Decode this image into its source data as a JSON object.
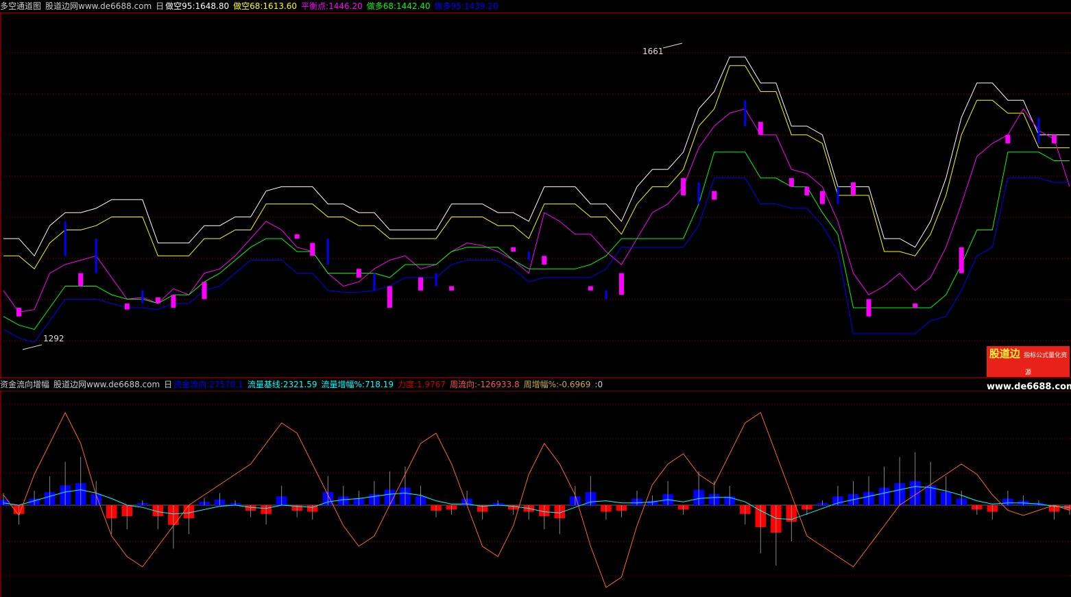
{
  "top_header": {
    "title": "多空通道图",
    "site": "股道边网www.de6688.com",
    "period": "日",
    "items": [
      {
        "label": "做空95:1648.80",
        "color": "#ffffff"
      },
      {
        "label": "做空68:1613.60",
        "color": "#ffff00"
      },
      {
        "label": "平衡点:1446.20",
        "color": "#ff00ff"
      },
      {
        "label": "做多68:1442.40",
        "color": "#00ff00"
      },
      {
        "label": "做多95:1439.20",
        "color": "#0000ff"
      }
    ]
  },
  "bottom_header": {
    "title": "资金流向增幅",
    "site": "股道边网www.de6688.com",
    "period": "日",
    "items": [
      {
        "label": "资金流向:27570.1",
        "color": "#0000ff"
      },
      {
        "label": "流量基线:2321.59",
        "color": "#00ffff"
      },
      {
        "label": "流量增幅%:718.19",
        "color": "#00ffff"
      },
      {
        "label": "力度:1.9767",
        "color": "#cc0000"
      },
      {
        "label": "周流向:-126933.8",
        "color": "#ff5555"
      },
      {
        "label": "周增幅%:-0.6969",
        "color": "#ccaa44"
      },
      {
        "label": ":0",
        "color": "#cccccc"
      }
    ]
  },
  "watermark": {
    "line1": "股道边",
    "line1_small": "指标公式量化资源",
    "line2": "www.de6688.com"
  },
  "colors": {
    "grid": "#a00000",
    "border": "#cc0000",
    "up_candle": "#ff00ff",
    "down_candle": "#0000ff"
  },
  "chart_data": [
    {
      "type": "line",
      "title": "多空通道图",
      "annotations": [
        {
          "text": "1661"
        },
        {
          "text": "1292"
        }
      ],
      "series": [
        {
          "name": "做空95",
          "color": "#ffffff",
          "values": [
            1440,
            1440,
            1420,
            1455,
            1470,
            1470,
            1475,
            1485,
            1485,
            1485,
            1435,
            1435,
            1435,
            1455,
            1455,
            1465,
            1465,
            1495,
            1500,
            1500,
            1500,
            1480,
            1480,
            1470,
            1470,
            1450,
            1450,
            1450,
            1450,
            1480,
            1480,
            1480,
            1470,
            1470,
            1460,
            1500,
            1500,
            1500,
            1480,
            1480,
            1460,
            1500,
            1520,
            1520,
            1540,
            1590,
            1610,
            1650,
            1650,
            1620,
            1620,
            1570,
            1570,
            1560,
            1500,
            1500,
            1500,
            1440,
            1440,
            1430,
            1460,
            1510,
            1580,
            1620,
            1620,
            1600,
            1600,
            1560,
            1560,
            1560
          ]
        },
        {
          "name": "做空68",
          "color": "#ffff00",
          "values": [
            1420,
            1420,
            1405,
            1435,
            1450,
            1450,
            1455,
            1465,
            1465,
            1465,
            1420,
            1420,
            1420,
            1440,
            1440,
            1450,
            1450,
            1480,
            1480,
            1480,
            1480,
            1465,
            1465,
            1455,
            1455,
            1440,
            1440,
            1440,
            1440,
            1465,
            1465,
            1465,
            1455,
            1455,
            1440,
            1480,
            1480,
            1480,
            1465,
            1465,
            1445,
            1480,
            1500,
            1500,
            1520,
            1570,
            1590,
            1640,
            1640,
            1610,
            1610,
            1560,
            1560,
            1550,
            1490,
            1490,
            1490,
            1425,
            1425,
            1420,
            1445,
            1490,
            1560,
            1600,
            1600,
            1585,
            1585,
            1545,
            1545,
            1545
          ]
        },
        {
          "name": "平衡点",
          "color": "#ff00ff",
          "values": [
            1380,
            1355,
            1358,
            1400,
            1410,
            1415,
            1420,
            1395,
            1370,
            1372,
            1365,
            1382,
            1375,
            1400,
            1405,
            1420,
            1440,
            1460,
            1450,
            1430,
            1425,
            1400,
            1385,
            1390,
            1405,
            1415,
            1420,
            1405,
            1410,
            1425,
            1435,
            1432,
            1425,
            1415,
            1400,
            1470,
            1460,
            1445,
            1445,
            1425,
            1410,
            1440,
            1470,
            1480,
            1500,
            1545,
            1570,
            1585,
            1590,
            1560,
            1560,
            1520,
            1515,
            1500,
            1460,
            1400,
            1375,
            1385,
            1400,
            1380,
            1395,
            1430,
            1480,
            1535,
            1550,
            1560,
            1590,
            1565,
            1555,
            1500
          ]
        },
        {
          "name": "做多68",
          "color": "#00ff00",
          "values": [
            1350,
            1340,
            1335,
            1360,
            1385,
            1385,
            1385,
            1375,
            1370,
            1370,
            1365,
            1375,
            1375,
            1390,
            1400,
            1415,
            1430,
            1440,
            1440,
            1425,
            1425,
            1400,
            1400,
            1400,
            1400,
            1395,
            1410,
            1410,
            1410,
            1425,
            1430,
            1430,
            1430,
            1415,
            1405,
            1405,
            1405,
            1405,
            1410,
            1420,
            1440,
            1440,
            1440,
            1440,
            1440,
            1480,
            1540,
            1540,
            1540,
            1510,
            1510,
            1500,
            1500,
            1470,
            1445,
            1360,
            1360,
            1360,
            1360,
            1360,
            1360,
            1375,
            1410,
            1450,
            1450,
            1540,
            1540,
            1540,
            1530,
            1530
          ]
        },
        {
          "name": "做多95",
          "color": "#0000ff",
          "values": [
            1335,
            1325,
            1320,
            1345,
            1370,
            1370,
            1370,
            1365,
            1360,
            1360,
            1358,
            1365,
            1365,
            1380,
            1385,
            1400,
            1415,
            1415,
            1415,
            1400,
            1400,
            1380,
            1378,
            1378,
            1380,
            1385,
            1395,
            1395,
            1395,
            1410,
            1415,
            1415,
            1415,
            1405,
            1390,
            1395,
            1395,
            1395,
            1395,
            1405,
            1430,
            1430,
            1430,
            1430,
            1430,
            1455,
            1510,
            1510,
            1510,
            1480,
            1480,
            1475,
            1475,
            1455,
            1425,
            1330,
            1330,
            1330,
            1330,
            1330,
            1345,
            1350,
            1380,
            1420,
            1430,
            1510,
            1510,
            1510,
            1505,
            1505
          ]
        }
      ],
      "candles": [
        {
          "i": 1,
          "o": 1360,
          "c": 1350,
          "up": true
        },
        {
          "i": 4,
          "o": 1420,
          "c": 1460,
          "up": false
        },
        {
          "i": 5,
          "o": 1400,
          "c": 1385,
          "up": true
        },
        {
          "i": 6,
          "o": 1440,
          "c": 1400,
          "up": false
        },
        {
          "i": 8,
          "o": 1365,
          "c": 1358,
          "up": true
        },
        {
          "i": 9,
          "o": 1380,
          "c": 1365,
          "up": false
        },
        {
          "i": 10,
          "o": 1372,
          "c": 1365,
          "up": true
        },
        {
          "i": 11,
          "o": 1375,
          "c": 1360,
          "up": true
        },
        {
          "i": 13,
          "o": 1390,
          "c": 1370,
          "up": true
        },
        {
          "i": 19,
          "o": 1440,
          "c": 1445,
          "up": true
        },
        {
          "i": 20,
          "o": 1435,
          "c": 1420,
          "up": true
        },
        {
          "i": 21,
          "o": 1440,
          "c": 1410,
          "up": false
        },
        {
          "i": 23,
          "o": 1405,
          "c": 1395,
          "up": true
        },
        {
          "i": 24,
          "o": 1400,
          "c": 1380,
          "up": false
        },
        {
          "i": 25,
          "o": 1385,
          "c": 1360,
          "up": true
        },
        {
          "i": 27,
          "o": 1395,
          "c": 1380,
          "up": true
        },
        {
          "i": 28,
          "o": 1400,
          "c": 1385,
          "up": false
        },
        {
          "i": 29,
          "o": 1385,
          "c": 1380,
          "up": true
        },
        {
          "i": 33,
          "o": 1430,
          "c": 1425,
          "up": true
        },
        {
          "i": 34,
          "o": 1425,
          "c": 1415,
          "up": false
        },
        {
          "i": 35,
          "o": 1420,
          "c": 1410,
          "up": true
        },
        {
          "i": 38,
          "o": 1385,
          "c": 1380,
          "up": true
        },
        {
          "i": 39,
          "o": 1380,
          "c": 1370,
          "up": false
        },
        {
          "i": 40,
          "o": 1400,
          "c": 1375,
          "up": true
        },
        {
          "i": 44,
          "o": 1510,
          "c": 1490,
          "up": true
        },
        {
          "i": 45,
          "o": 1505,
          "c": 1480,
          "up": false
        },
        {
          "i": 46,
          "o": 1495,
          "c": 1485,
          "up": true
        },
        {
          "i": 48,
          "o": 1600,
          "c": 1570,
          "up": false
        },
        {
          "i": 49,
          "o": 1575,
          "c": 1560,
          "up": true
        },
        {
          "i": 51,
          "o": 1510,
          "c": 1500,
          "up": true
        },
        {
          "i": 52,
          "o": 1500,
          "c": 1490,
          "up": true
        },
        {
          "i": 53,
          "o": 1495,
          "c": 1480,
          "up": true
        },
        {
          "i": 54,
          "o": 1500,
          "c": 1480,
          "up": false
        },
        {
          "i": 55,
          "o": 1505,
          "c": 1490,
          "up": true
        },
        {
          "i": 56,
          "o": 1370,
          "c": 1350,
          "up": true
        },
        {
          "i": 59,
          "o": 1365,
          "c": 1360,
          "up": true
        },
        {
          "i": 62,
          "o": 1430,
          "c": 1400,
          "up": true
        },
        {
          "i": 65,
          "o": 1560,
          "c": 1550,
          "up": true
        },
        {
          "i": 67,
          "o": 1580,
          "c": 1550,
          "up": false
        },
        {
          "i": 68,
          "o": 1560,
          "c": 1550,
          "up": true
        }
      ],
      "ylim": [
        1280,
        1700
      ]
    },
    {
      "type": "bar",
      "title": "资金流向增幅",
      "series": [
        {
          "name": "资金流向",
          "color_pos": "#0000ff",
          "color_neg": "#ff0000",
          "values": [
            5,
            -8,
            6,
            12,
            18,
            20,
            10,
            -12,
            -10,
            2,
            -10,
            -18,
            -12,
            3,
            5,
            2,
            -5,
            -8,
            8,
            -5,
            -6,
            12,
            8,
            6,
            10,
            14,
            16,
            8,
            -5,
            -4,
            6,
            -6,
            2,
            -4,
            -6,
            -10,
            -12,
            8,
            12,
            -6,
            -5,
            6,
            4,
            10,
            -4,
            14,
            10,
            8,
            -8,
            -20,
            -25,
            -15,
            -4,
            2,
            8,
            10,
            12,
            16,
            20,
            22,
            18,
            12,
            6,
            -4,
            -6,
            6,
            4,
            2,
            -6,
            -4
          ]
        },
        {
          "name": "流量基线",
          "color": "#00ffff",
          "values": [
            2,
            0,
            4,
            8,
            12,
            14,
            11,
            6,
            0,
            -2,
            -6,
            -8,
            -7,
            -4,
            -1,
            0,
            -2,
            -3,
            0,
            -1,
            -2,
            3,
            5,
            6,
            8,
            10,
            11,
            9,
            4,
            1,
            1,
            -1,
            0,
            -1,
            -3,
            -6,
            -7,
            -2,
            3,
            4,
            2,
            2,
            3,
            5,
            3,
            6,
            7,
            7,
            3,
            -5,
            -12,
            -13,
            -8,
            -3,
            2,
            5,
            8,
            11,
            14,
            17,
            16,
            13,
            9,
            4,
            1,
            2,
            2,
            1,
            -1,
            -2
          ]
        },
        {
          "name": "流量增幅%",
          "color": "#ff6a2a",
          "values": [
            10,
            -10,
            30,
            60,
            90,
            60,
            10,
            -30,
            -50,
            -60,
            -40,
            -20,
            0,
            10,
            20,
            30,
            40,
            60,
            80,
            70,
            40,
            10,
            -20,
            -40,
            -30,
            0,
            30,
            60,
            70,
            40,
            0,
            -40,
            -50,
            -20,
            30,
            60,
            40,
            10,
            -40,
            -80,
            -70,
            -20,
            20,
            40,
            50,
            30,
            20,
            50,
            80,
            90,
            50,
            10,
            -30,
            -40,
            -50,
            -60,
            -40,
            -20,
            0,
            10,
            20,
            30,
            40,
            30,
            10,
            -5,
            -10,
            -5,
            0,
            -5
          ]
        }
      ],
      "ylim": [
        -100,
        100
      ]
    }
  ]
}
